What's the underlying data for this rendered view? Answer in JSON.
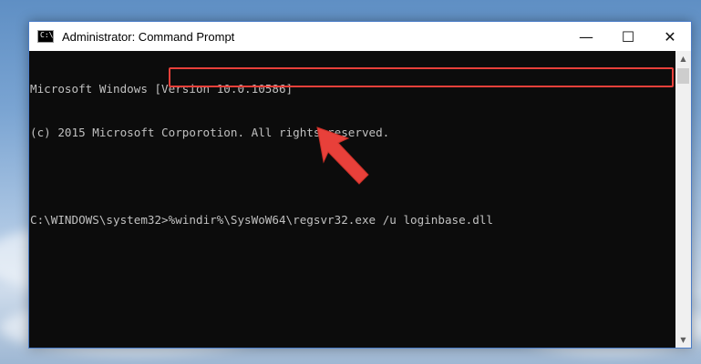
{
  "window": {
    "title": "Administrator: Command Prompt",
    "icon_label": "C:\\",
    "controls": {
      "minimize": "—",
      "maximize": "☐",
      "close": "✕"
    }
  },
  "console": {
    "lines": [
      "Microsoft Windows [Version 10.0.10586]",
      "(c) 2015 Microsoft Corporotion. All rights reserved.",
      ""
    ],
    "prompt": "C:\\WINDOWS\\system32>",
    "command": "%windir%\\SysWoW64\\regsvr32.exe /u loginbase.dll"
  },
  "scrollbar": {
    "up": "▲",
    "down": "▼"
  },
  "colors": {
    "highlight": "#e8403a",
    "arrow": "#e8403a",
    "console_bg": "#0c0c0c",
    "console_text": "#c0c0c0"
  }
}
